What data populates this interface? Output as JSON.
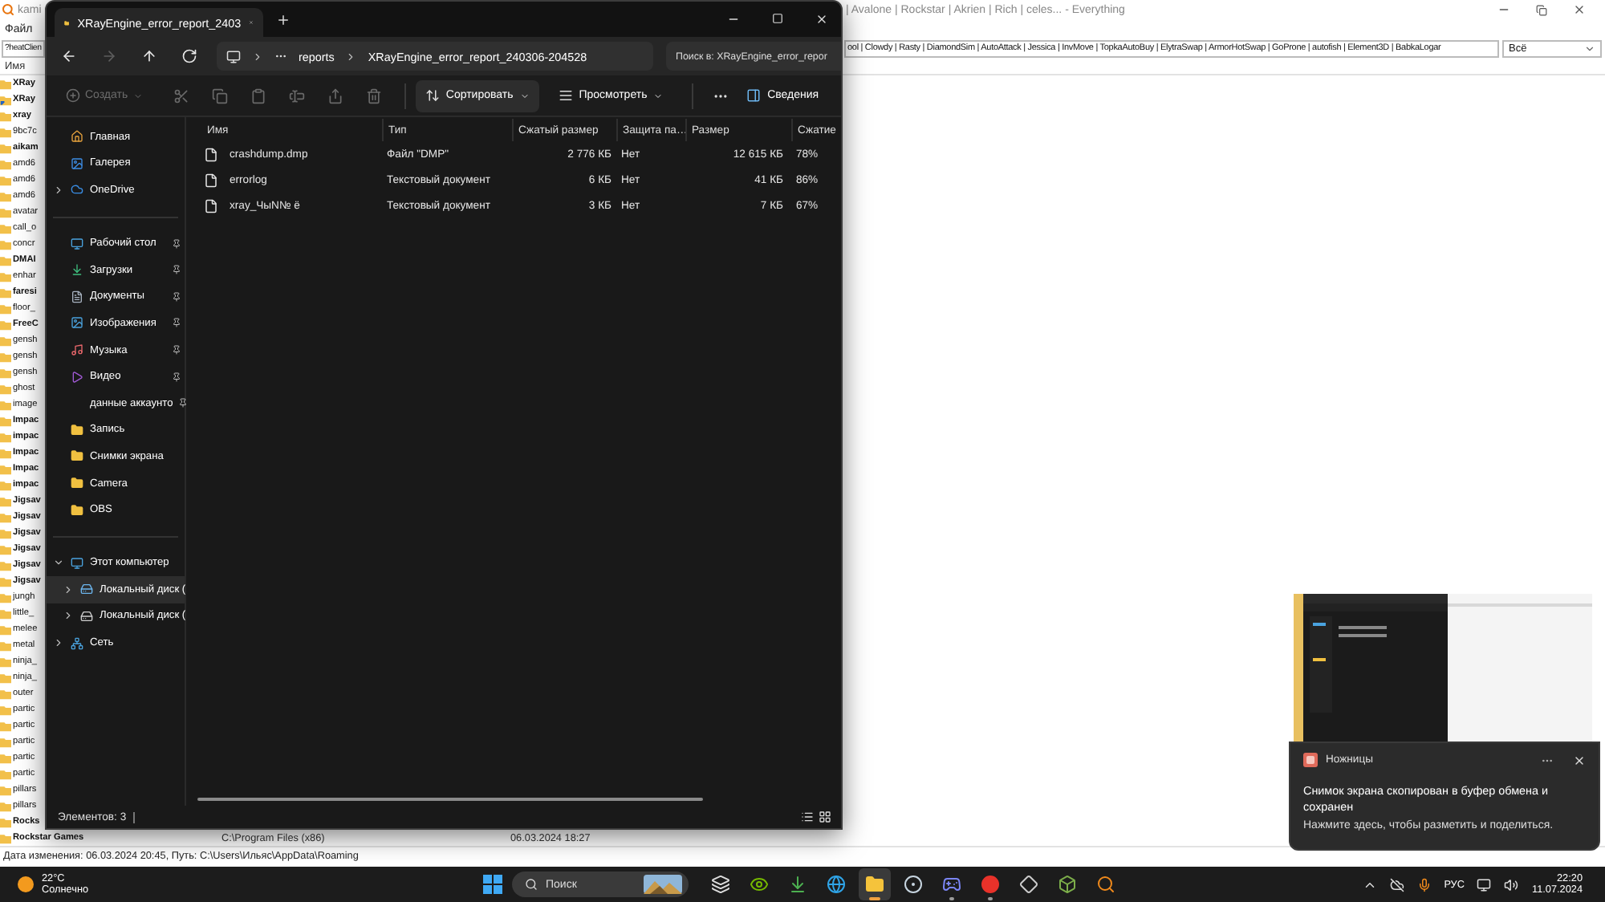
{
  "everything": {
    "title_left": "kami",
    "title_right": "| Avalone | Rockstar | Akrien | Rich | celes... - Everything",
    "menu": [
      "Файл"
    ],
    "search_left": "?heatClien",
    "search_right": "ool | Clowdy | Rasty | DiamondSim | AutoAttack | Jessica | InvMove | TopkaAutoBuy | ElytraSwap | ArmorHotSwap | GoProne | autofish | Element3D | BabkaLogar",
    "filter": "Всё",
    "column": "Имя",
    "rows": [
      {
        "name": "XRay",
        "bold": true,
        "kind": "folder"
      },
      {
        "name": "XRay",
        "bold": true,
        "kind": "shortcut"
      },
      {
        "name": "xray",
        "bold": true,
        "kind": "folder"
      },
      {
        "name": "9bc7c",
        "bold": false,
        "kind": "folder"
      },
      {
        "name": "aikam",
        "bold": true,
        "kind": "folder"
      },
      {
        "name": "amd6",
        "bold": false,
        "kind": "folder"
      },
      {
        "name": "amd6",
        "bold": false,
        "kind": "folder"
      },
      {
        "name": "amd6",
        "bold": false,
        "kind": "folder"
      },
      {
        "name": "avatar",
        "bold": false,
        "kind": "folder"
      },
      {
        "name": "call_o",
        "bold": false,
        "kind": "folder"
      },
      {
        "name": "concr",
        "bold": false,
        "kind": "folder"
      },
      {
        "name": "DMAI",
        "bold": true,
        "kind": "folder"
      },
      {
        "name": "enhar",
        "bold": false,
        "kind": "folder"
      },
      {
        "name": "faresi",
        "bold": true,
        "kind": "folder"
      },
      {
        "name": "floor_",
        "bold": false,
        "kind": "folder"
      },
      {
        "name": "FreeC",
        "bold": true,
        "kind": "folder"
      },
      {
        "name": "gensh",
        "bold": false,
        "kind": "folder"
      },
      {
        "name": "gensh",
        "bold": false,
        "kind": "folder"
      },
      {
        "name": "gensh",
        "bold": false,
        "kind": "folder"
      },
      {
        "name": "ghost",
        "bold": false,
        "kind": "folder"
      },
      {
        "name": "image",
        "bold": false,
        "kind": "folder"
      },
      {
        "name": "Impac",
        "bold": true,
        "kind": "folder"
      },
      {
        "name": "impac",
        "bold": true,
        "kind": "folder"
      },
      {
        "name": "Impac",
        "bold": true,
        "kind": "folder"
      },
      {
        "name": "Impac",
        "bold": true,
        "kind": "folder"
      },
      {
        "name": "impac",
        "bold": true,
        "kind": "folder"
      },
      {
        "name": "Jigsav",
        "bold": true,
        "kind": "folder"
      },
      {
        "name": "Jigsav",
        "bold": true,
        "kind": "folder"
      },
      {
        "name": "Jigsav",
        "bold": true,
        "kind": "folder"
      },
      {
        "name": "Jigsav",
        "bold": true,
        "kind": "folder"
      },
      {
        "name": "Jigsav",
        "bold": true,
        "kind": "folder"
      },
      {
        "name": "Jigsav",
        "bold": true,
        "kind": "folder"
      },
      {
        "name": "jungh",
        "bold": false,
        "kind": "folder"
      },
      {
        "name": "little_",
        "bold": false,
        "kind": "folder"
      },
      {
        "name": "melee",
        "bold": false,
        "kind": "folder"
      },
      {
        "name": "metal",
        "bold": false,
        "kind": "folder"
      },
      {
        "name": "ninja_",
        "bold": false,
        "kind": "folder"
      },
      {
        "name": "ninja_",
        "bold": false,
        "kind": "folder"
      },
      {
        "name": "outer",
        "bold": false,
        "kind": "folder"
      },
      {
        "name": "partic",
        "bold": false,
        "kind": "folder"
      },
      {
        "name": "partic",
        "bold": false,
        "kind": "folder"
      },
      {
        "name": "partic",
        "bold": false,
        "kind": "folder"
      },
      {
        "name": "partic",
        "bold": false,
        "kind": "folder"
      },
      {
        "name": "partic",
        "bold": false,
        "kind": "folder"
      },
      {
        "name": "pillars",
        "bold": false,
        "kind": "folder"
      },
      {
        "name": "pillars",
        "bold": false,
        "kind": "folder"
      },
      {
        "name": "Rocks",
        "bold": true,
        "kind": "folder"
      },
      {
        "name": "Rockstar Games",
        "bold": true,
        "kind": "folder",
        "path": "C:\\Program Files (x86)",
        "modified": "06.03.2024 18:27"
      }
    ],
    "status": "Дата изменения: 06.03.2024 20:45, Путь: C:\\Users\\Ильяс\\AppData\\Roaming"
  },
  "explorer": {
    "tabs": [
      {
        "label": "XRayEngine_error_report_2403",
        "selected": true
      }
    ],
    "nav": [
      {
        "kind": "back",
        "disabled": false
      },
      {
        "kind": "forward",
        "disabled": true
      },
      {
        "kind": "up",
        "disabled": false
      },
      {
        "kind": "refresh",
        "disabled": false
      }
    ],
    "breadcrumb": [
      "reports",
      "XRayEngine_error_report_240306-204528"
    ],
    "search_placeholder": "Поиск в: XRayEngine_error_repor",
    "toolbar": {
      "create": {
        "label": "Создать",
        "disabled": true
      },
      "icon_buttons": [
        {
          "kind": "cut",
          "disabled": true
        },
        {
          "kind": "copy",
          "disabled": true
        },
        {
          "kind": "paste",
          "disabled": true
        },
        {
          "kind": "rename",
          "disabled": true
        },
        {
          "kind": "share",
          "disabled": true
        },
        {
          "kind": "delete",
          "disabled": true
        }
      ],
      "sort": "Сортировать",
      "view": "Просмотреть",
      "details": "Сведения"
    },
    "sidebar": [
      {
        "items": [
          {
            "label": "Главная",
            "kind": "home",
            "selected": false
          },
          {
            "label": "Галерея",
            "kind": "gallery",
            "selected": false
          },
          {
            "label": "OneDrive",
            "kind": "cloud",
            "selected": false,
            "expanded": false
          }
        ]
      },
      {
        "items": [
          {
            "label": "Рабочий стол",
            "kind": "desktop",
            "selected": false,
            "pinned": true
          },
          {
            "label": "Загрузки",
            "kind": "download",
            "selected": false,
            "pinned": true
          },
          {
            "label": "Документы",
            "kind": "documents",
            "selected": false,
            "pinned": true
          },
          {
            "label": "Изображения",
            "kind": "images",
            "selected": false,
            "pinned": true
          },
          {
            "label": "Музыка",
            "kind": "music",
            "selected": false,
            "pinned": true
          },
          {
            "label": "Видео",
            "kind": "video",
            "selected": false,
            "pinned": true
          },
          {
            "label": "данные аккаунто",
            "kind": "none",
            "selected": false,
            "pinned": true
          },
          {
            "label": "Запись",
            "kind": "folder",
            "selected": false
          },
          {
            "label": "Снимки экрана",
            "kind": "folder",
            "selected": false
          },
          {
            "label": "Camera",
            "kind": "folder",
            "selected": false
          },
          {
            "label": "OBS",
            "kind": "folder",
            "selected": false
          }
        ]
      },
      {
        "items": [
          {
            "label": "Этот компьютер",
            "kind": "pc",
            "selected": false,
            "expanded": true,
            "children": [
              {
                "label": "Локальный диск (",
                "kind": "system_drive",
                "selected": true,
                "expanded": false
              },
              {
                "label": "Локальный диск (",
                "kind": "drive",
                "selected": false,
                "expanded": false
              }
            ]
          },
          {
            "label": "Сеть",
            "kind": "network",
            "selected": false,
            "expanded": false
          }
        ]
      }
    ],
    "columns": [
      "Имя",
      "Тип",
      "Сжатый размер",
      "Защита па…",
      "Размер",
      "Сжатие"
    ],
    "files": [
      {
        "name": "crashdump.dmp",
        "type": "Файл \"DMP\"",
        "compressed": "2 776 КБ",
        "protection": "Нет",
        "size": "12 615 КБ",
        "ratio": "78%"
      },
      {
        "name": "errorlog",
        "type": "Текстовый документ",
        "compressed": "6 КБ",
        "protection": "Нет",
        "size": "41 КБ",
        "ratio": "86%"
      },
      {
        "name": "xray_ЧыN№ ё",
        "type": "Текстовый документ",
        "compressed": "3 КБ",
        "protection": "Нет",
        "size": "7 КБ",
        "ratio": "67%"
      }
    ],
    "status": "Элементов: 3"
  },
  "notification": {
    "app": "Ножницы",
    "title": "Снимок экрана скопирован в буфер обмена и сохранен",
    "body": "Нажмите здесь, чтобы разметить и поделиться."
  },
  "taskbar": {
    "weather": {
      "temp": "22°C",
      "condition": "Солнечно"
    },
    "search": "Поиск",
    "apps": [
      {
        "kind": "taskview",
        "running": false,
        "selected": false
      },
      {
        "kind": "nvidia",
        "running": false,
        "selected": false
      },
      {
        "kind": "download",
        "running": false,
        "selected": false
      },
      {
        "kind": "edge",
        "running": false,
        "selected": false
      },
      {
        "kind": "explorer",
        "running": true,
        "selected": true
      },
      {
        "kind": "steam",
        "running": false,
        "selected": false
      },
      {
        "kind": "discord",
        "running": true,
        "selected": false
      },
      {
        "kind": "yandex",
        "running": true,
        "selected": false
      },
      {
        "kind": "roblox",
        "running": false,
        "selected": false
      },
      {
        "kind": "minecraft",
        "running": false,
        "selected": false
      },
      {
        "kind": "everything",
        "running": false,
        "selected": false
      }
    ],
    "language": "РУС",
    "time": "22:20",
    "date": "11.07.2024"
  }
}
